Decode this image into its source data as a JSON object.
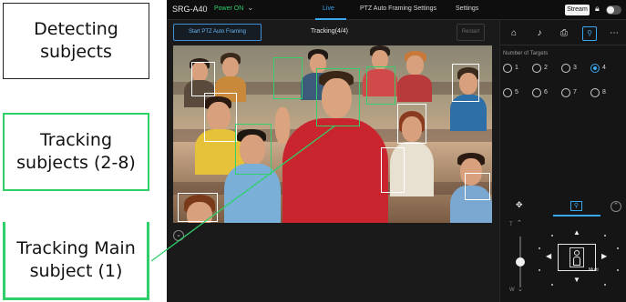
{
  "callouts": {
    "detecting": [
      "Detecting",
      "subjects"
    ],
    "tracking": [
      "Tracking",
      "subjects (2-8)"
    ],
    "main": [
      "Tracking Main",
      "subject (1)"
    ]
  },
  "topbar": {
    "model": "SRG-A40",
    "power": "Power ON",
    "nav": [
      "Live",
      "PTZ Auto Framing Settings",
      "Settings"
    ],
    "active_nav": "Live",
    "stream_button": "Stream"
  },
  "toolbar": {
    "start_button": "Start PTZ Auto Framing",
    "tracking_status": "Tracking(4/4)",
    "restart_button": "Restart"
  },
  "panel": {
    "tabs": [
      "home-icon",
      "music-note-icon",
      "preset-icon",
      "person-frame-icon",
      "more-icon"
    ],
    "active_tab": "person-frame-icon",
    "targets_label": "Number of Targets",
    "targets": [
      "1",
      "2",
      "3",
      "4",
      "5",
      "6",
      "7",
      "8"
    ],
    "selected_target": "4",
    "ptz": {
      "zoom_tele": "T",
      "zoom_wide": "W",
      "zoom_level": 0.5,
      "mode_label": "Multi"
    }
  },
  "colors": {
    "accent": "#39a6f0",
    "tracking_green": "#34d06c",
    "power_green": "#2fd06a"
  }
}
